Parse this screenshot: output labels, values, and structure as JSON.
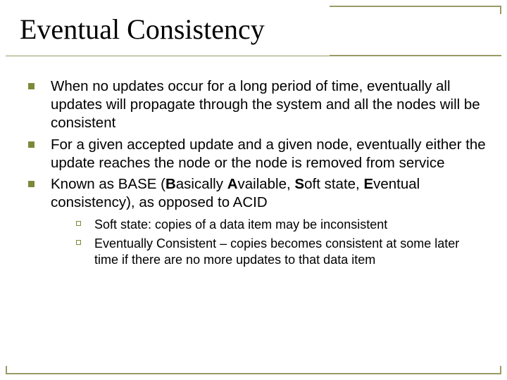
{
  "title": "Eventual Consistency",
  "bullets": {
    "b1": "When no updates occur for a long period of time, eventually all updates will propagate through the system and all the nodes will be consistent",
    "b2": "For a given accepted update and a given node, eventually either the update reaches the node or the node is removed from service",
    "b3_pre": "Known as BASE (",
    "b3_b": "B",
    "b3_t1": "asically ",
    "b3_a": "A",
    "b3_t2": "vailable, ",
    "b3_s": "S",
    "b3_t3": "oft state, ",
    "b3_e": "E",
    "b3_t4": "ventual consistency), as opposed to ACID"
  },
  "subbullets": {
    "s1": "Soft state: copies of a data item may be inconsistent",
    "s2": "Eventually Consistent – copies becomes consistent at some later time if there are no more updates to that data item"
  }
}
